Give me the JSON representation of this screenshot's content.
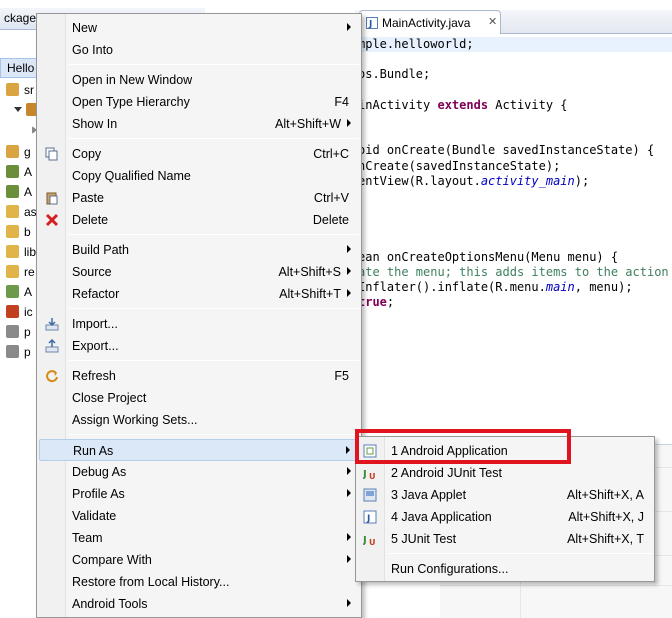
{
  "package_explorer": {
    "tab_label": "ckage E",
    "project_label": "Hello",
    "tree_items": [
      {
        "label": "sr",
        "icon": "source-folder-icon"
      },
      {
        "label": "",
        "icon": "package-icon"
      },
      {
        "label": "",
        "icon": "expand-icon"
      },
      {
        "label": "g",
        "icon": "gen-folder-icon"
      },
      {
        "label": "A",
        "icon": "library-icon"
      },
      {
        "label": "A",
        "icon": "library-icon"
      },
      {
        "label": "as",
        "icon": "folder-icon"
      },
      {
        "label": "b",
        "icon": "folder-icon"
      },
      {
        "label": "lib",
        "icon": "folder-icon"
      },
      {
        "label": "re",
        "icon": "folder-icon"
      },
      {
        "label": "A",
        "icon": "manifest-icon"
      },
      {
        "label": "ic",
        "icon": "image-icon"
      },
      {
        "label": "p",
        "icon": "file-icon"
      },
      {
        "label": "p",
        "icon": "file-icon"
      }
    ]
  },
  "editor": {
    "tab_label": "MainActivity.java",
    "code_lines": [
      "mple.helloworld;",
      "",
      "os.Bundle;",
      "",
      "inActivity extends Activity {",
      "",
      "",
      "oid onCreate(Bundle savedInstanceState) {",
      "nCreate(savedInstanceState);",
      "entView(R.layout.activity_main);",
      "",
      "",
      "",
      "",
      "ean onCreateOptionsMenu(Menu menu) {",
      "ate the menu; this adds items to the action b",
      "Inflater().inflate(R.menu.main, menu);",
      "true;"
    ]
  },
  "context_menu": {
    "items": [
      {
        "label": "New",
        "accel": "",
        "submenu": true,
        "icon": ""
      },
      {
        "label": "Go Into",
        "accel": "",
        "submenu": false,
        "icon": ""
      },
      {
        "label": "Open in New Window",
        "accel": "",
        "submenu": false,
        "icon": ""
      },
      {
        "label": "Open Type Hierarchy",
        "accel": "F4",
        "submenu": false,
        "icon": ""
      },
      {
        "label": "Show In",
        "accel": "Alt+Shift+W",
        "submenu": true,
        "icon": ""
      },
      {
        "label": "Copy",
        "accel": "Ctrl+C",
        "submenu": false,
        "icon": "copy-icon"
      },
      {
        "label": "Copy Qualified Name",
        "accel": "",
        "submenu": false,
        "icon": ""
      },
      {
        "label": "Paste",
        "accel": "Ctrl+V",
        "submenu": false,
        "icon": "paste-icon"
      },
      {
        "label": "Delete",
        "accel": "Delete",
        "submenu": false,
        "icon": "delete-icon"
      },
      {
        "label": "Build Path",
        "accel": "",
        "submenu": true,
        "icon": ""
      },
      {
        "label": "Source",
        "accel": "Alt+Shift+S",
        "submenu": true,
        "icon": ""
      },
      {
        "label": "Refactor",
        "accel": "Alt+Shift+T",
        "submenu": true,
        "icon": ""
      },
      {
        "label": "Import...",
        "accel": "",
        "submenu": false,
        "icon": "import-icon"
      },
      {
        "label": "Export...",
        "accel": "",
        "submenu": false,
        "icon": "export-icon"
      },
      {
        "label": "Refresh",
        "accel": "F5",
        "submenu": false,
        "icon": "refresh-icon"
      },
      {
        "label": "Close Project",
        "accel": "",
        "submenu": false,
        "icon": ""
      },
      {
        "label": "Assign Working Sets...",
        "accel": "",
        "submenu": false,
        "icon": ""
      },
      {
        "label": "Run As",
        "accel": "",
        "submenu": true,
        "icon": ""
      },
      {
        "label": "Debug As",
        "accel": "",
        "submenu": true,
        "icon": ""
      },
      {
        "label": "Profile As",
        "accel": "",
        "submenu": true,
        "icon": ""
      },
      {
        "label": "Validate",
        "accel": "",
        "submenu": false,
        "icon": ""
      },
      {
        "label": "Team",
        "accel": "",
        "submenu": true,
        "icon": ""
      },
      {
        "label": "Compare With",
        "accel": "",
        "submenu": true,
        "icon": ""
      },
      {
        "label": "Restore from Local History...",
        "accel": "",
        "submenu": false,
        "icon": ""
      },
      {
        "label": "Android Tools",
        "accel": "",
        "submenu": true,
        "icon": ""
      }
    ]
  },
  "run_as_submenu": {
    "items": [
      {
        "label": "1 Android Application",
        "accel": "",
        "icon": "android-app-icon"
      },
      {
        "label": "2 Android JUnit Test",
        "accel": "",
        "icon": "junit-icon"
      },
      {
        "label": "3 Java Applet",
        "accel": "Alt+Shift+X, A",
        "icon": "java-applet-icon"
      },
      {
        "label": "4 Java Application",
        "accel": "Alt+Shift+X, J",
        "icon": "java-app-icon"
      },
      {
        "label": "5 JUnit Test",
        "accel": "Alt+Shift+X, T",
        "icon": "junit-icon"
      },
      {
        "label": "Run Configurations...",
        "accel": "",
        "icon": ""
      }
    ]
  },
  "colors": {
    "highlight_box": "#e0141e",
    "menu_selection": "#dbe8f7",
    "keyword": "#7f0055"
  }
}
